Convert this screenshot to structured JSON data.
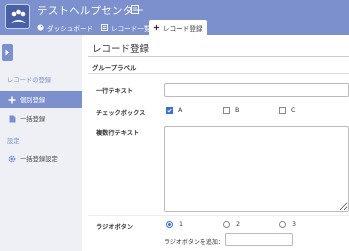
{
  "app": {
    "title": "テストヘルプセンター",
    "title_icon": "book-icon"
  },
  "tabs": [
    {
      "label": "ダッシュボード",
      "icon": "dashboard-icon",
      "active": false
    },
    {
      "label": "レコード一覧",
      "icon": "list-icon",
      "active": false
    },
    {
      "label": "レコード登録",
      "icon": "plus-icon",
      "active": true
    }
  ],
  "sidebar": {
    "section_records": "レコードの登録",
    "items": [
      {
        "label": "個別登録",
        "icon": "plus-icon",
        "active": true
      },
      {
        "label": "一括登録",
        "icon": "file-icon",
        "active": false
      }
    ],
    "section_settings": "設定",
    "settings_items": [
      {
        "label": "一括登録設定",
        "icon": "gear-icon"
      }
    ]
  },
  "main": {
    "page_title": "レコード登録",
    "group_label": "グループラベル",
    "fields": {
      "single_line": {
        "label": "一行テキスト",
        "value": ""
      },
      "checkbox": {
        "label": "チェックボックス",
        "options": [
          {
            "label": "A",
            "checked": true
          },
          {
            "label": "B",
            "checked": false
          },
          {
            "label": "C",
            "checked": false
          }
        ]
      },
      "multi_line": {
        "label": "複数行テキスト",
        "value": ""
      },
      "radio": {
        "label": "ラジオボタン",
        "options": [
          {
            "label": "1",
            "selected": true
          },
          {
            "label": "2",
            "selected": false
          },
          {
            "label": "3",
            "selected": false
          }
        ],
        "add_label": "ラジオボタンを追加：",
        "add_value": ""
      }
    }
  },
  "colors": {
    "brand": "#7b90cd",
    "accent": "#3a6fd8"
  }
}
